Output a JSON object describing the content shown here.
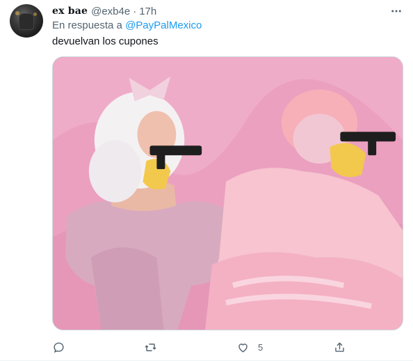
{
  "tweet": {
    "author_name": "ex bae",
    "handle": "@exb4e",
    "separator": "·",
    "time": "17h",
    "reply_prefix": "En respuesta a",
    "reply_to": "@PayPalMexico",
    "text": "devuelvan los cupones",
    "media_alt": "",
    "like_count": "5"
  },
  "icons": {
    "more": "more-icon",
    "reply": "reply-icon",
    "retweet": "retweet-icon",
    "like": "heart-icon",
    "share": "share-icon"
  },
  "colors": {
    "link": "#1d9bf0",
    "muted": "#536471",
    "text": "#0f1419"
  }
}
